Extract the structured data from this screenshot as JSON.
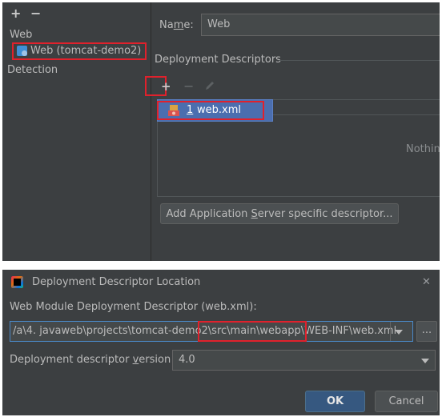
{
  "facets_panel": {
    "toolbar": {
      "add_glyph": "+",
      "remove_glyph": "−"
    },
    "tree": {
      "group_label": "Web",
      "facet_item_label": "Web (tomcat-demo2)",
      "detection_label": "Detection"
    },
    "name_label_prefix": "Na",
    "name_label_mnemonic": "m",
    "name_label_suffix": "e:",
    "name_value": "Web",
    "section_title": "Deployment Descriptors",
    "desc_toolbar": {
      "add_glyph": "+",
      "remove_glyph": "−"
    },
    "descriptors": [
      {
        "index": "1",
        "file": "web.xml"
      }
    ],
    "right_overflow_text": "Nothing",
    "add_server_button": {
      "prefix": "Add Application ",
      "mnemonic": "S",
      "suffix": "erver specific descriptor..."
    }
  },
  "dialog": {
    "title": "Deployment Descriptor Location",
    "close_glyph": "✕",
    "path_label": "Web Module Deployment Descriptor (web.xml):",
    "path_value": "/a\\4. javaweb\\projects\\tomcat-demo2\\src\\main\\webapp\\WEB-INF\\web.xml",
    "browse_label": "...",
    "version_label_prefix": "Deployment descriptor ",
    "version_label_mnemonic": "v",
    "version_label_suffix": "ersion",
    "version_value": "4.0",
    "ok_label": "OK",
    "cancel_label": "Cancel"
  },
  "colors": {
    "panel_bg": "#3c3f41",
    "field_bg": "#45494a",
    "selection": "#4b6eaf",
    "highlight_red": "#e0212c",
    "ok_button": "#365880",
    "focus_border": "#4a88c7"
  },
  "icons": {
    "facet": "web-facet-icon",
    "descriptor": "xml-file-icon",
    "app": "intellij-idea-icon",
    "edit": "pencil-icon"
  }
}
